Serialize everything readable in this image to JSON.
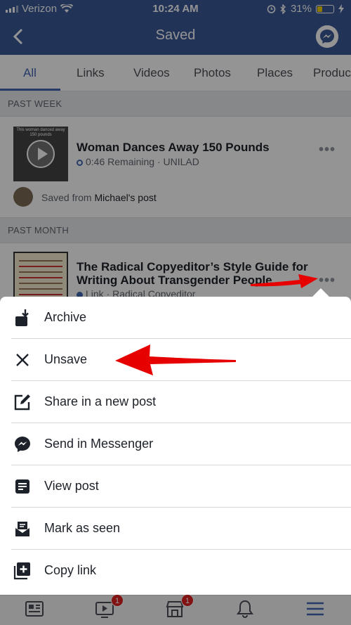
{
  "status_bar": {
    "carrier": "Verizon",
    "time": "10:24 AM",
    "battery": "31%",
    "battery_level": 0.31
  },
  "header": {
    "title": "Saved",
    "back_icon": "chevron-left-icon",
    "messenger_icon": "messenger-icon"
  },
  "tabs": [
    {
      "label": "All",
      "active": true
    },
    {
      "label": "Links"
    },
    {
      "label": "Videos"
    },
    {
      "label": "Photos"
    },
    {
      "label": "Places"
    },
    {
      "label": "Produc"
    }
  ],
  "sections": [
    {
      "heading": "PAST WEEK",
      "item": {
        "title": "Woman Dances Away 150 Pounds",
        "meta": "0:46 Remaining · UNILAD",
        "thumb_caption": "This woman danced away 150 pounds",
        "saved_prefix": "Saved from",
        "saved_source": "Michael's post"
      }
    },
    {
      "heading": "PAST MONTH",
      "item": {
        "title_line1": "The Radical Copyeditor’s Style Guide for",
        "title_line2": "Writing About Transgender People",
        "meta": "Link · Radical Copyeditor"
      }
    }
  ],
  "actions": [
    {
      "label": "Archive",
      "icon": "archive-icon"
    },
    {
      "label": "Unsave",
      "icon": "close-icon"
    },
    {
      "label": "Share in a new post",
      "icon": "compose-icon"
    },
    {
      "label": "Send in Messenger",
      "icon": "messenger-icon"
    },
    {
      "label": "View post",
      "icon": "post-icon"
    },
    {
      "label": "Mark as seen",
      "icon": "inbox-icon"
    },
    {
      "label": "Copy link",
      "icon": "copy-link-icon"
    }
  ],
  "bottom_bar": [
    {
      "icon": "news-feed-icon"
    },
    {
      "icon": "watch-icon",
      "badge": "1"
    },
    {
      "icon": "marketplace-icon",
      "badge": "1"
    },
    {
      "icon": "notifications-icon"
    },
    {
      "icon": "menu-icon",
      "active": true
    }
  ],
  "colors": {
    "brand": "#3b5998",
    "accent": "#4267b2",
    "annotation_arrow": "#e60000"
  }
}
